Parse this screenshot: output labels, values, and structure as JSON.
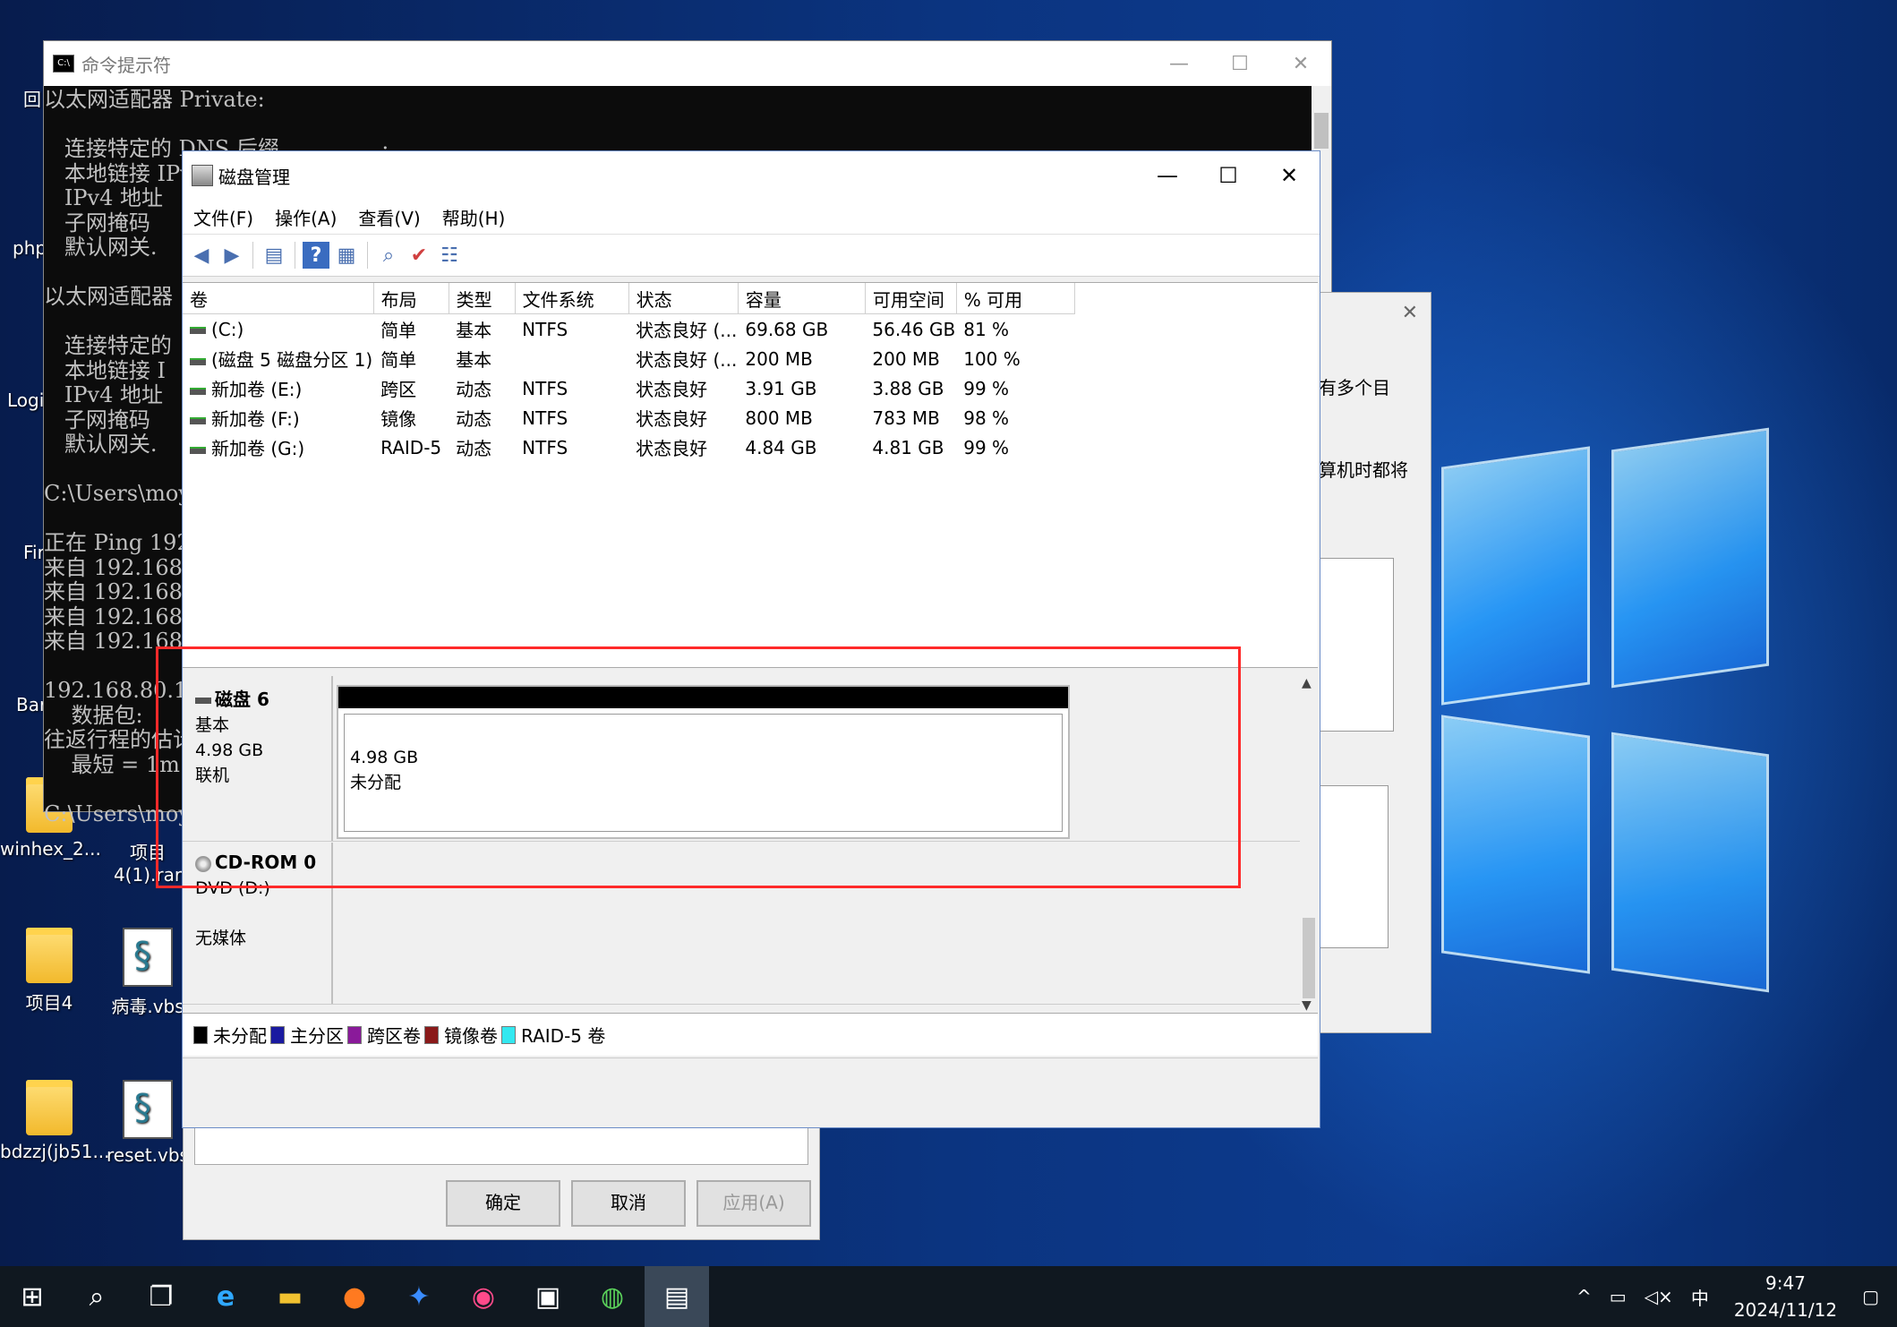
{
  "desktop": {
    "icons": [
      {
        "label": "winhex_2...",
        "kind": "folder"
      },
      {
        "label": "项目4(1).rar",
        "kind": "folder"
      },
      {
        "label": "项目4",
        "kind": "folder"
      },
      {
        "label": "病毒.vbs",
        "kind": "script"
      },
      {
        "label": "bdzzj(jb51...",
        "kind": "folder"
      },
      {
        "label": "reset.vbs",
        "kind": "script"
      }
    ],
    "partial_labels": [
      "回",
      "php",
      "Logi",
      "Fir",
      "Bar"
    ]
  },
  "cmd": {
    "title": "命令提示符",
    "lines": [
      "以太网适配器 Private:",
      "",
      "   连接特定的 DNS 后缀 . . . . . . . :",
      "   本地链接 IPv6 地址",
      "   IPv4 地址",
      "   子网掩码",
      "   默认网关.",
      "",
      "以太网适配器",
      "",
      "   连接特定的",
      "   本地链接 I",
      "   IPv4 地址",
      "   子网掩码",
      "   默认网关.",
      "",
      "C:\\Users\\moyu",
      "",
      "正在 Ping 192",
      "来自 192.168.",
      "来自 192.168.",
      "来自 192.168.",
      "来自 192.168.",
      "",
      "192.168.80.10",
      "    数据包:",
      "往返行程的估计",
      "    最短 = 1m",
      "",
      "C:\\Users\\moyu"
    ]
  },
  "bg_dialog": {
    "text1": "有多个目",
    "text2": "算机时都将",
    "buttons": {
      "ok": "确定",
      "cancel": "取消",
      "apply": "应用(A)"
    }
  },
  "diskmgmt": {
    "title": "磁盘管理",
    "menu": [
      "文件(F)",
      "操作(A)",
      "查看(V)",
      "帮助(H)"
    ],
    "columns": [
      "卷",
      "布局",
      "类型",
      "文件系统",
      "状态",
      "容量",
      "可用空间",
      "% 可用"
    ],
    "rows": [
      [
        "(C:)",
        "简单",
        "基本",
        "NTFS",
        "状态良好 (...",
        "69.68 GB",
        "56.46 GB",
        "81 %"
      ],
      [
        "(磁盘 5 磁盘分区 1)",
        "简单",
        "基本",
        "",
        "状态良好 (...",
        "200 MB",
        "200 MB",
        "100 %"
      ],
      [
        "新加卷 (E:)",
        "跨区",
        "动态",
        "NTFS",
        "状态良好",
        "3.91 GB",
        "3.88 GB",
        "99 %"
      ],
      [
        "新加卷 (F:)",
        "镜像",
        "动态",
        "NTFS",
        "状态良好",
        "800 MB",
        "783 MB",
        "98 %"
      ],
      [
        "新加卷 (G:)",
        "RAID-5",
        "动态",
        "NTFS",
        "状态良好",
        "4.84 GB",
        "4.81 GB",
        "99 %"
      ]
    ],
    "disk6": {
      "name": "磁盘 6",
      "type": "基本",
      "size": "4.98 GB",
      "state": "联机",
      "partition_size": "4.98 GB",
      "partition_label": "未分配"
    },
    "cdrom": {
      "name": "CD-ROM 0",
      "drive": "DVD (D:)",
      "media": "无媒体"
    },
    "legend": [
      {
        "label": "未分配",
        "color": "#000000"
      },
      {
        "label": "主分区",
        "color": "#1a1aa0"
      },
      {
        "label": "跨区卷",
        "color": "#8a1a9a"
      },
      {
        "label": "镜像卷",
        "color": "#8a1a1a"
      },
      {
        "label": "RAID-5 卷",
        "color": "#33e8f0"
      }
    ]
  },
  "taskbar": {
    "items": [
      "start-icon",
      "search-icon",
      "task-view-icon",
      "ie-icon",
      "explorer-icon",
      "firefox-icon",
      "app-icon",
      "chrome-icon",
      "cmd-icon",
      "network-icon",
      "disk-management-icon"
    ],
    "ime": "中",
    "time": "9:47",
    "date": "2024/11/12"
  }
}
